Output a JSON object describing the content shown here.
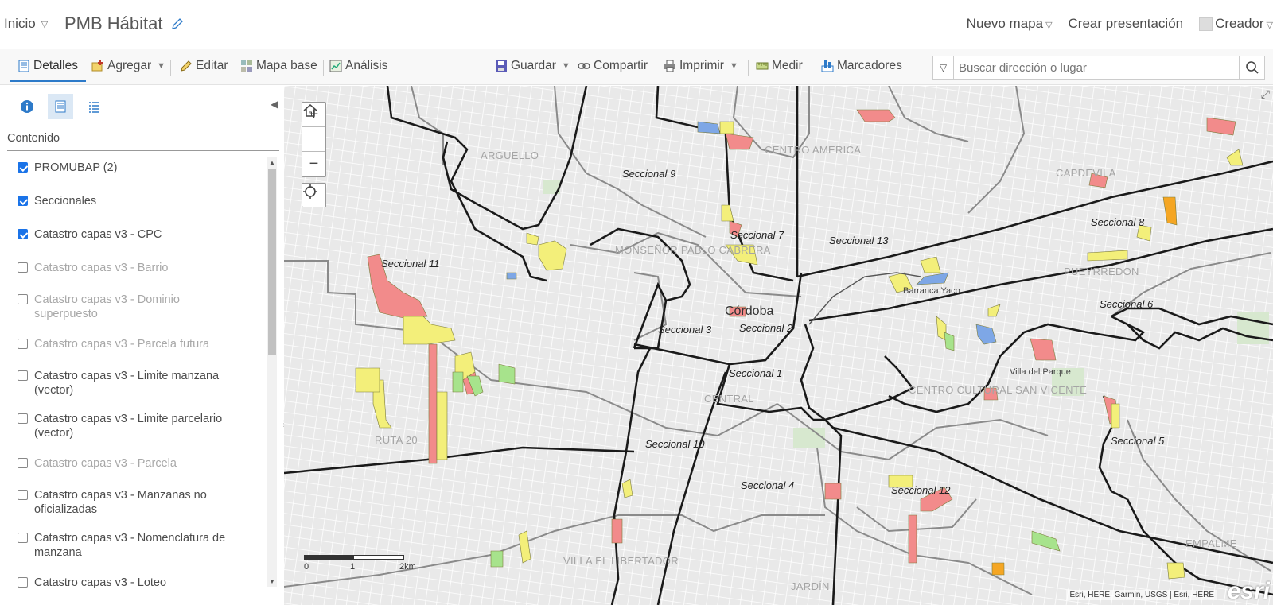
{
  "header": {
    "home_label": "Inicio",
    "map_title": "PMB Hábitat",
    "new_map": "Nuevo mapa",
    "create_presentation": "Crear presentación",
    "user_role": "Creador"
  },
  "toolbar": {
    "details": "Detalles",
    "add": "Agregar",
    "edit": "Editar",
    "basemap": "Mapa base",
    "analysis": "Análisis",
    "save": "Guardar",
    "share": "Compartir",
    "print": "Imprimir",
    "measure": "Medir",
    "bookmarks": "Marcadores",
    "search_placeholder": "Buscar dirección o lugar"
  },
  "sidebar": {
    "contents_title": "Contenido",
    "layers": [
      {
        "label": "PROMUBAP (2)",
        "checked": true,
        "visible_in_scale": true
      },
      {
        "label": "Seccionales",
        "checked": true,
        "visible_in_scale": true
      },
      {
        "label": "Catastro capas v3 - CPC",
        "checked": true,
        "visible_in_scale": true
      },
      {
        "label": "Catastro capas v3 - Barrio",
        "checked": false,
        "visible_in_scale": false
      },
      {
        "label": "Catastro capas v3 - Dominio superpuesto",
        "checked": false,
        "visible_in_scale": false
      },
      {
        "label": "Catastro capas v3 - Parcela futura",
        "checked": false,
        "visible_in_scale": false
      },
      {
        "label": "Catastro capas v3 - Limite manzana (vector)",
        "checked": false,
        "visible_in_scale": true
      },
      {
        "label": "Catastro capas v3 - Limite parcelario (vector)",
        "checked": false,
        "visible_in_scale": true
      },
      {
        "label": "Catastro capas v3 - Parcela",
        "checked": false,
        "visible_in_scale": false
      },
      {
        "label": "Catastro capas v3 - Manzanas no oficializadas",
        "checked": false,
        "visible_in_scale": true
      },
      {
        "label": "Catastro capas v3 - Nomenclatura de manzana",
        "checked": false,
        "visible_in_scale": true
      },
      {
        "label": "Catastro capas v3 - Loteo",
        "checked": false,
        "visible_in_scale": true
      }
    ]
  },
  "map": {
    "seccionales": [
      "Seccional 9",
      "Seccional 7",
      "Seccional 13",
      "Seccional 8",
      "Seccional 11",
      "Seccional 3",
      "Seccional 2",
      "Seccional 1",
      "Seccional 6",
      "Seccional 10",
      "Seccional 4",
      "Seccional 5",
      "Seccional 12"
    ],
    "areas": [
      "ARGUELLO",
      "CENTRO AMERICA",
      "CAPDEVILA",
      "MONSEÑOR PABLO CABRERA",
      "PUEYRREDON",
      "CENTRO CULTURAL SAN VICENTE",
      "CENTRAL",
      "RUTA 20",
      "VILLA EL LIBERTADOR",
      "EMPALME",
      "JARDÍN"
    ],
    "city": "Córdoba",
    "places": [
      "Barranca Yaco",
      "Villa del Parque"
    ],
    "scale_labels": [
      "0",
      "1",
      "2km"
    ],
    "attribution": "Esri, HERE, Garmin, USGS | Esri, HERE",
    "logo_text": "esri",
    "colors": {
      "red": "#f28b8b",
      "yellow": "#f3ef7a",
      "green": "#a7e38c",
      "blue": "#7ea7e6",
      "orange": "#f5a623",
      "boundary": "#1a1a1a",
      "road": "#8a8a8a"
    }
  }
}
